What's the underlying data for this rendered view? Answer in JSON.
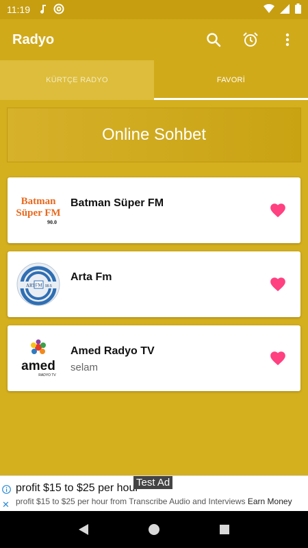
{
  "status_bar": {
    "time": "11:19",
    "icons": [
      "music-note-icon",
      "at-sign-icon",
      "wifi-icon",
      "signal-icon",
      "battery-icon"
    ]
  },
  "app_bar": {
    "title": "Radyo",
    "actions": [
      "search-icon",
      "alarm-icon",
      "more-vert-icon"
    ]
  },
  "tabs": [
    {
      "label": "KÜRTÇE RADYO",
      "active": false
    },
    {
      "label": "FAVORİ",
      "active": true
    }
  ],
  "banner": {
    "label": "Online Sohbet"
  },
  "stations": [
    {
      "name": "Batman Süper FM",
      "subtitle": "",
      "logo": {
        "line1": "Batman",
        "line2": "Süper FM",
        "line3": "90.0"
      },
      "favorite": true
    },
    {
      "name": "Arta Fm",
      "subtitle": "",
      "logo": {
        "line1": "ARTA",
        "line2": "FM",
        "line3": "99.5"
      },
      "favorite": true
    },
    {
      "name": "Amed Radyo TV",
      "subtitle": "selam",
      "logo": {
        "line1": "amed",
        "line2": "RADYO TV"
      },
      "favorite": true
    }
  ],
  "ad": {
    "badge": "Test Ad",
    "headline": "profit $15 to $25 per hour",
    "body": "profit $15 to $25 per hour from Transcribe Audio and Interviews",
    "cta": "Earn Money"
  },
  "colors": {
    "accent": "#d1aa1a",
    "background": "#d4af1e",
    "heart": "#ff4081",
    "status_bar": "#c69e10"
  }
}
